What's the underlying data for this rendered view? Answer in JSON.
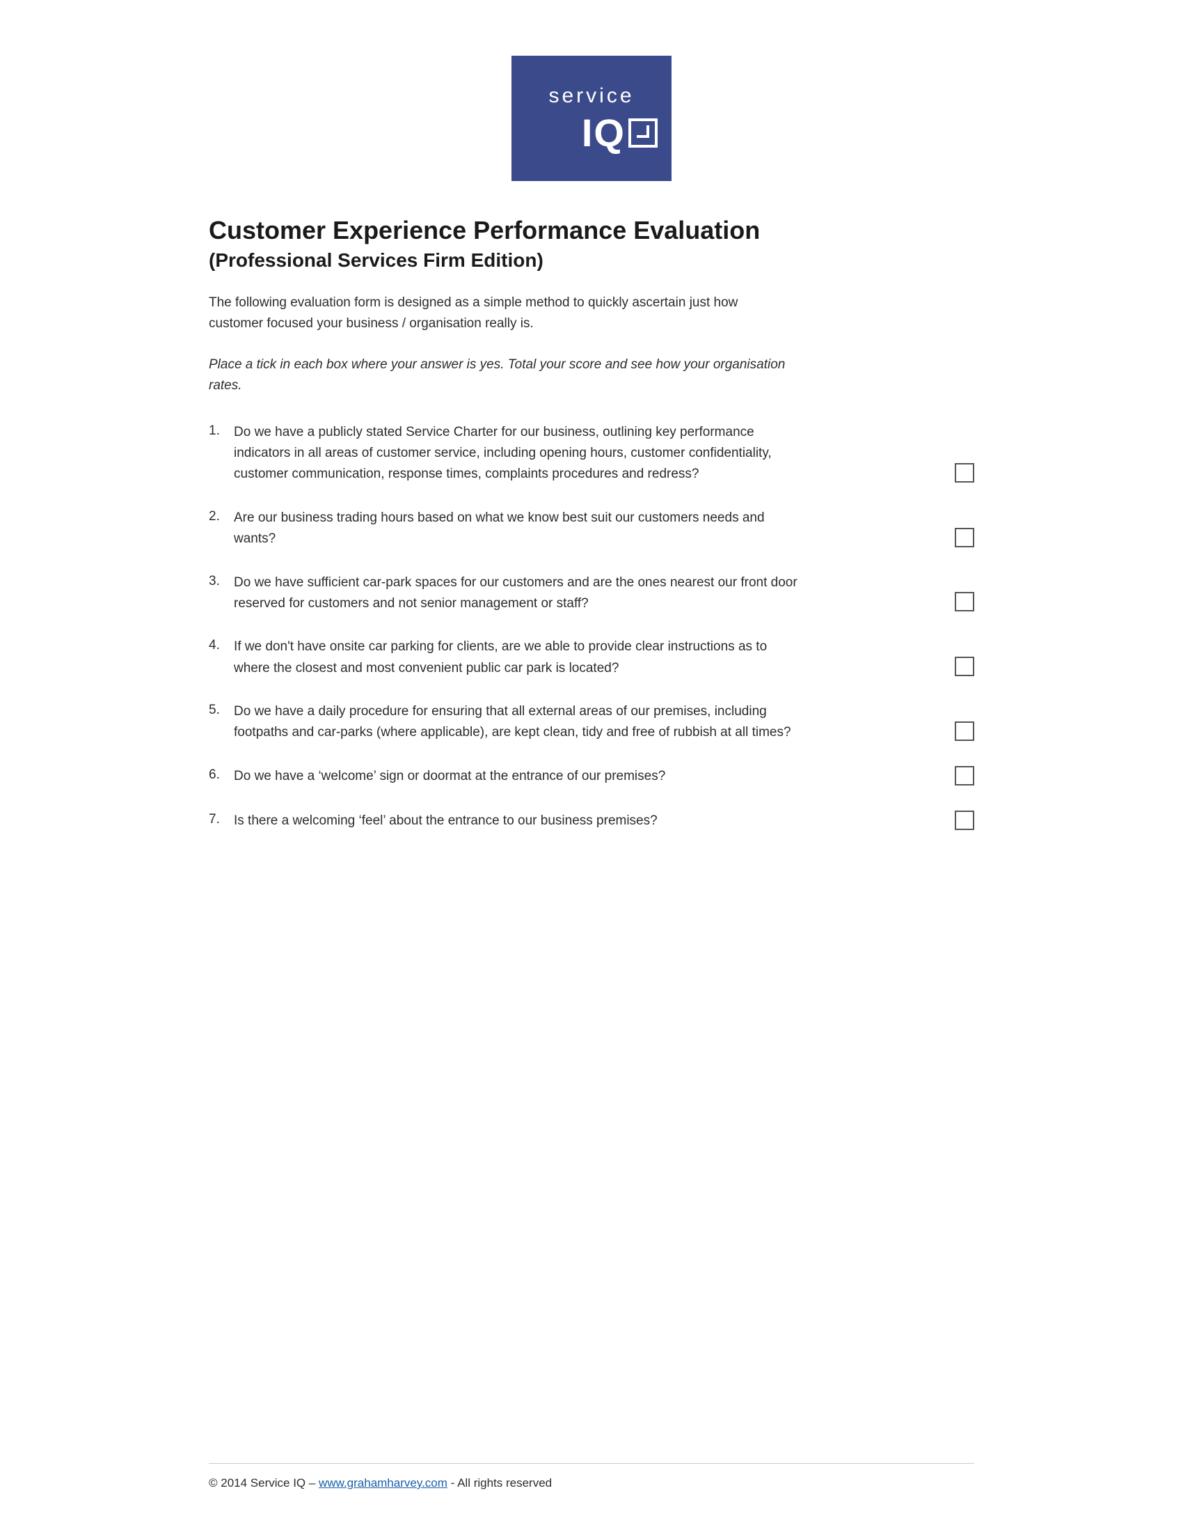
{
  "logo": {
    "service_text": "service",
    "iq_text": "IQ",
    "alt": "Service IQ Logo"
  },
  "header": {
    "main_title": "Customer Experience Performance Evaluation",
    "sub_title": "(Professional Services Firm Edition)"
  },
  "intro": {
    "paragraph1": "The following evaluation form is designed as a simple method to quickly ascertain just how customer focused your business / organisation really is.",
    "paragraph2": "Place a tick in each box where your answer is yes. Total your score and see how your organisation rates."
  },
  "questions": [
    {
      "number": "1.",
      "text": "Do we have a publicly stated Service Charter for our business, outlining key performance indicators in all areas of customer service, including opening hours, customer confidentiality, customer communication, response times, complaints procedures and redress?"
    },
    {
      "number": "2.",
      "text": "Are our business trading hours based on what we know best suit our customers needs and wants?"
    },
    {
      "number": "3.",
      "text": "Do we have sufficient car-park spaces for our customers and are the ones nearest our front door reserved for customers and not senior management or staff?"
    },
    {
      "number": "4.",
      "text": "If we don't have onsite car parking for clients, are we able to provide clear instructions as to where the closest and most convenient public car park is located?"
    },
    {
      "number": "5.",
      "text": "Do we have a daily procedure for ensuring that all external areas of our premises, including footpaths and car-parks (where applicable), are kept clean, tidy and free of rubbish at all times?"
    },
    {
      "number": "6.",
      "text": "Do we have a ‘welcome’ sign or doormat at the entrance of our premises?"
    },
    {
      "number": "7.",
      "text": "Is there a welcoming ‘feel’ about the entrance to our business premises?"
    }
  ],
  "footer": {
    "text_before_link": "© 2014 Service IQ – ",
    "link_text": "www.grahamharvey.com",
    "link_url": "http://www.grahamharvey.com",
    "text_after_link": " - All rights reserved"
  }
}
